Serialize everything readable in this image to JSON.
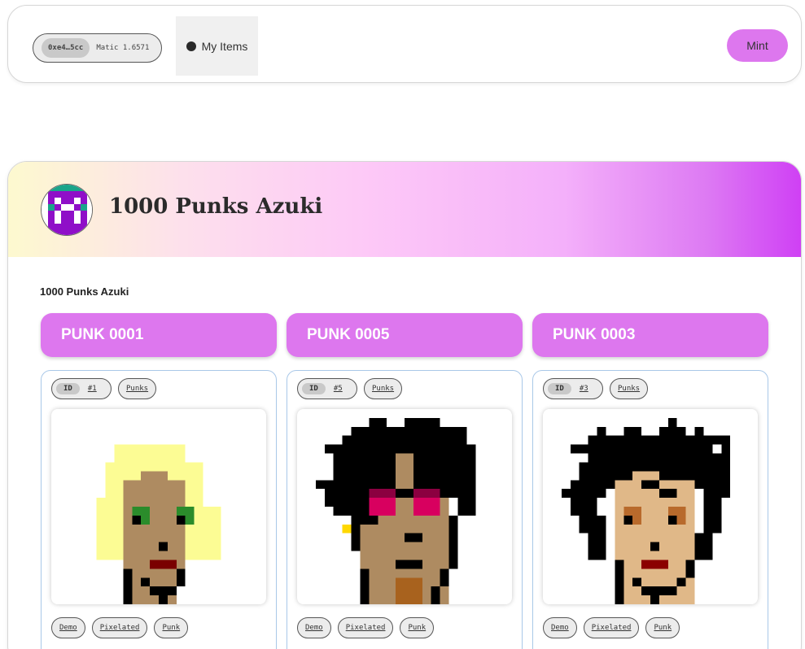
{
  "header": {
    "wallet_address": "0xe4…5cc",
    "wallet_balance": "Matic 1.6571",
    "my_items_label": "My Items",
    "mint_label": "Mint"
  },
  "collection": {
    "title": "1000 Punks Azuki",
    "subtitle": "1000 Punks Azuki",
    "accent_color": "#dd77ee",
    "nfts": [
      {
        "name": "PUNK 0001",
        "id_label": "ID",
        "id_value": "#1",
        "type_tag": "Punks",
        "tags": [
          "Demo",
          "Pixelated",
          "Punk"
        ],
        "image_icon": "punk-blonde-hair-icon"
      },
      {
        "name": "PUNK 0005",
        "id_label": "ID",
        "id_value": "#5",
        "type_tag": "Punks",
        "tags": [
          "Demo",
          "Pixelated",
          "Punk"
        ],
        "image_icon": "punk-wild-hair-sunglasses-icon"
      },
      {
        "name": "PUNK 0003",
        "id_label": "ID",
        "id_value": "#3",
        "type_tag": "Punks",
        "tags": [
          "Demo",
          "Pixelated",
          "Punk"
        ],
        "image_icon": "punk-wild-hair-icon"
      }
    ]
  }
}
